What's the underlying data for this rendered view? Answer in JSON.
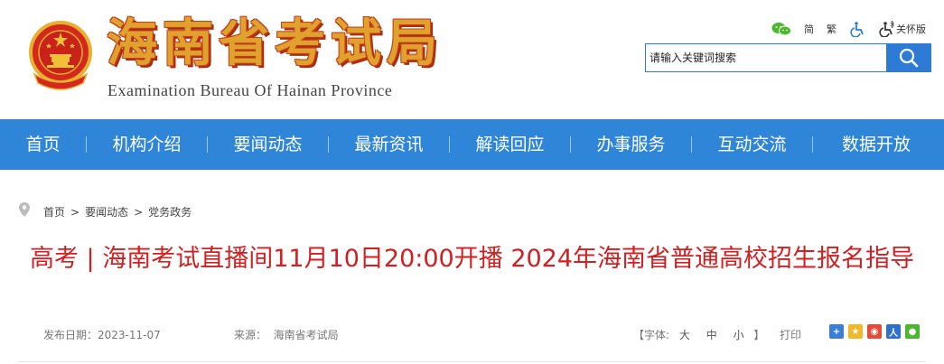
{
  "header": {
    "title_cn": "海南省考试局",
    "title_en": "Examination Bureau Of Hainan Province",
    "tools": {
      "simplified": "简",
      "traditional": "繁",
      "care_label": "关怀版"
    },
    "search": {
      "placeholder": "请输入关键词搜索"
    }
  },
  "nav": {
    "items": [
      "首页",
      "机构介绍",
      "要闻动态",
      "最新资讯",
      "解读回应",
      "办事服务",
      "互动交流",
      "数据开放"
    ]
  },
  "breadcrumb": {
    "home": "首页",
    "level1": "要闻动态",
    "level2": "党务政务",
    "separator": ">"
  },
  "article": {
    "title": "高考 | 海南考试直播间11月10日20:00开播 2024年海南省普通高校招生报名指导",
    "date_label": "发布日期：",
    "date": "2023-11-07",
    "source_label": "来源：",
    "source": "海南省考试局",
    "font_open": "【字体:",
    "font_large": "大",
    "font_medium": "中",
    "font_small": "小",
    "font_close": "】",
    "print": "打印"
  },
  "colors": {
    "nav_bg": "#2f86d8",
    "title_red": "#d31f1f",
    "brand_gold": "#e0a22c"
  }
}
